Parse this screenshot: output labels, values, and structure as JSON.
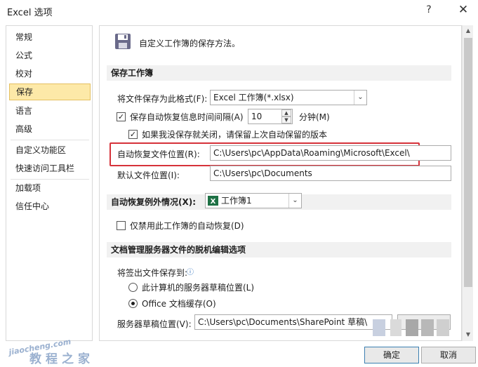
{
  "window": {
    "title": "Excel 选项",
    "help": "?",
    "close": "✕"
  },
  "sidebar": {
    "items": [
      {
        "label": "常规"
      },
      {
        "label": "公式"
      },
      {
        "label": "校对"
      },
      {
        "label": "保存"
      },
      {
        "label": "语言"
      },
      {
        "label": "高级"
      },
      {
        "label": "自定义功能区"
      },
      {
        "label": "快速访问工具栏"
      },
      {
        "label": "加载项"
      },
      {
        "label": "信任中心"
      }
    ],
    "selected": "保存"
  },
  "main": {
    "intro": "自定义工作簿的保存方法。",
    "save_section": {
      "title": "保存工作簿",
      "format_label": "将文件保存为此格式(F):",
      "format_value": "Excel 工作簿(*.xlsx)",
      "autorecover_label": "保存自动恢复信息时间间隔(A)",
      "autorecover_checked": true,
      "autorecover_minutes": "10",
      "minutes_label": "分钟(M)",
      "keep_last_label": "如果我没保存就关闭，请保留上次自动保留的版本",
      "keep_last_checked": true,
      "autorecover_path_label": "自动恢复文件位置(R):",
      "autorecover_path": "C:\\Users\\pc\\AppData\\Roaming\\Microsoft\\Excel\\",
      "default_path_label": "默认文件位置(I):",
      "default_path": "C:\\Users\\pc\\Documents"
    },
    "exception_section": {
      "title": "自动恢复例外情况(X):",
      "workbook_value": "工作簿1",
      "disable_label": "仅禁用此工作簿的自动恢复(D)",
      "disable_checked": false
    },
    "offline_section": {
      "title": "文档管理服务器文件的脱机编辑选项",
      "checkout_label": "将签出文件保存到:",
      "option_server_drafts": "此计算机的服务器草稿位置(L)",
      "option_office_cache": "Office 文档缓存(O)",
      "selected_option": "Office 文档缓存(O)",
      "drafts_location_label": "服务器草稿位置(V):",
      "drafts_location_value": "C:\\Users\\pc\\Documents\\SharePoint 草稿\\"
    }
  },
  "footer": {
    "ok_label": "确定",
    "cancel_label": "取消"
  },
  "watermark": {
    "text": "教程之家",
    "domain": "jiaocheng.com"
  },
  "colors": {
    "selected_bg": "#fde9a8",
    "highlight_border": "#d6323a",
    "excel_green": "#1e7145",
    "disk_icon": "#6a6a8a"
  }
}
